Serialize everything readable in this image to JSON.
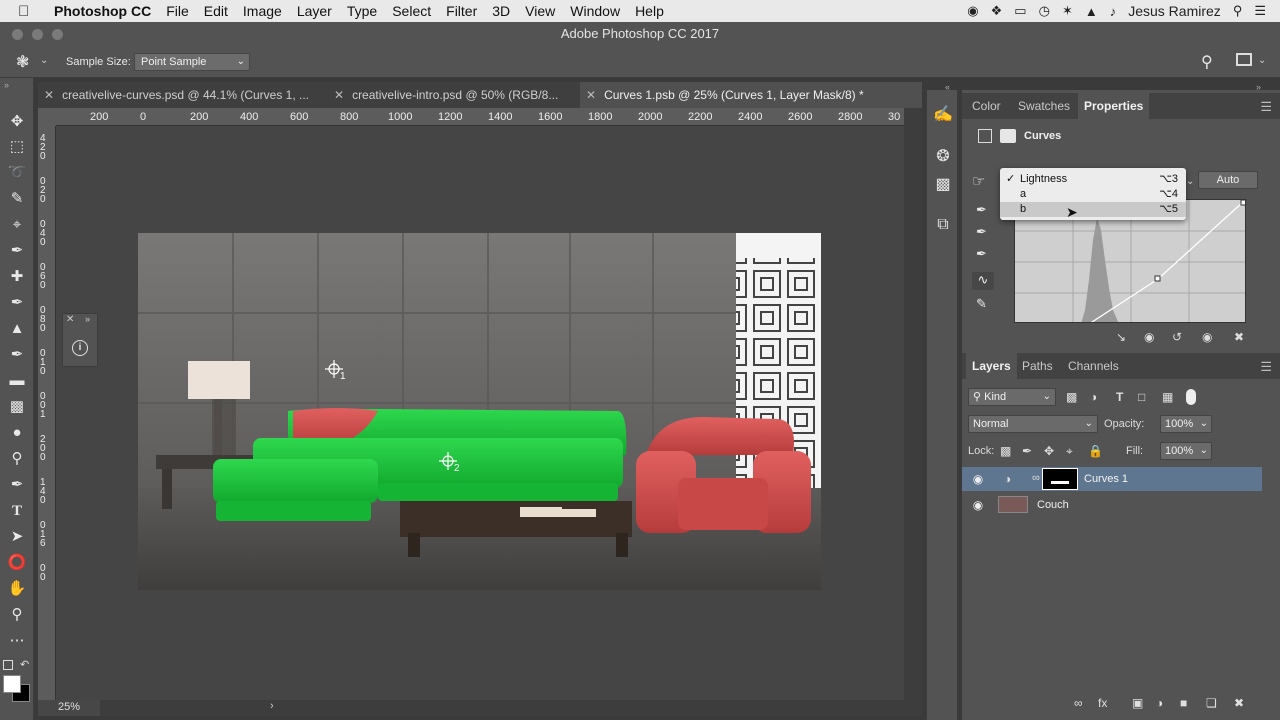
{
  "menubar": {
    "app_name": "Photoshop CC",
    "items": [
      "File",
      "Edit",
      "Image",
      "Layer",
      "Type",
      "Select",
      "Filter",
      "3D",
      "View",
      "Window",
      "Help"
    ],
    "user": "Jesus Ramirez"
  },
  "window": {
    "title": "Adobe Photoshop CC 2017"
  },
  "options_bar": {
    "sample_size_label": "Sample Size:",
    "sample_size_value": "Point Sample"
  },
  "document_tabs": [
    {
      "label": "creativelive-curves.psd @ 44.1% (Curves 1, ...",
      "active": false
    },
    {
      "label": "creativelive-intro.psd @ 50% (RGB/8...",
      "active": false
    },
    {
      "label": "Curves 1.psb @ 25% (Curves 1, Layer Mask/8) *",
      "active": true
    }
  ],
  "ruler_h": [
    "200",
    "0",
    "200",
    "400",
    "600",
    "800",
    "1000",
    "1200",
    "1400",
    "1600",
    "1800",
    "2000",
    "2200",
    "2400",
    "2600",
    "2800",
    "30"
  ],
  "ruler_v": [
    "4",
    "2",
    "0",
    "0",
    "2",
    "0",
    "0",
    "4",
    "0",
    "0",
    "6",
    "0",
    "0",
    "8",
    "0",
    "0",
    "1",
    "0",
    "0",
    "0",
    "1",
    "2",
    "0",
    "0",
    "1",
    "4",
    "0",
    "0",
    "1",
    "6",
    "0",
    "0"
  ],
  "status": {
    "zoom": "25%"
  },
  "properties_panel": {
    "tabs": [
      "Color",
      "Swatches",
      "Properties"
    ],
    "active_tab": "Properties",
    "adjustment_name": "Curves",
    "auto_label": "Auto",
    "channel_menu": [
      {
        "label": "Lightness",
        "shortcut": "⌥3",
        "checked": true
      },
      {
        "label": "a",
        "shortcut": "⌥4",
        "checked": false
      },
      {
        "label": "b",
        "shortcut": "⌥5",
        "checked": false,
        "hover": true
      }
    ]
  },
  "layers_panel": {
    "tabs": [
      "Layers",
      "Paths",
      "Channels"
    ],
    "active_tab": "Layers",
    "filter_kind": "Kind",
    "blend_mode": "Normal",
    "opacity_label": "Opacity:",
    "opacity_value": "100%",
    "lock_label": "Lock:",
    "fill_label": "Fill:",
    "fill_value": "100%",
    "layers": [
      {
        "name": "Curves 1",
        "selected": true
      },
      {
        "name": "Couch",
        "selected": false
      }
    ]
  },
  "canvas": {
    "sampler_1": "1",
    "sampler_2": "2"
  },
  "colors": {
    "sofa_green": "#19c43a",
    "armchair_red": "#d9504f",
    "panel_bg": "#535353",
    "selected_layer": "#5f7690"
  }
}
